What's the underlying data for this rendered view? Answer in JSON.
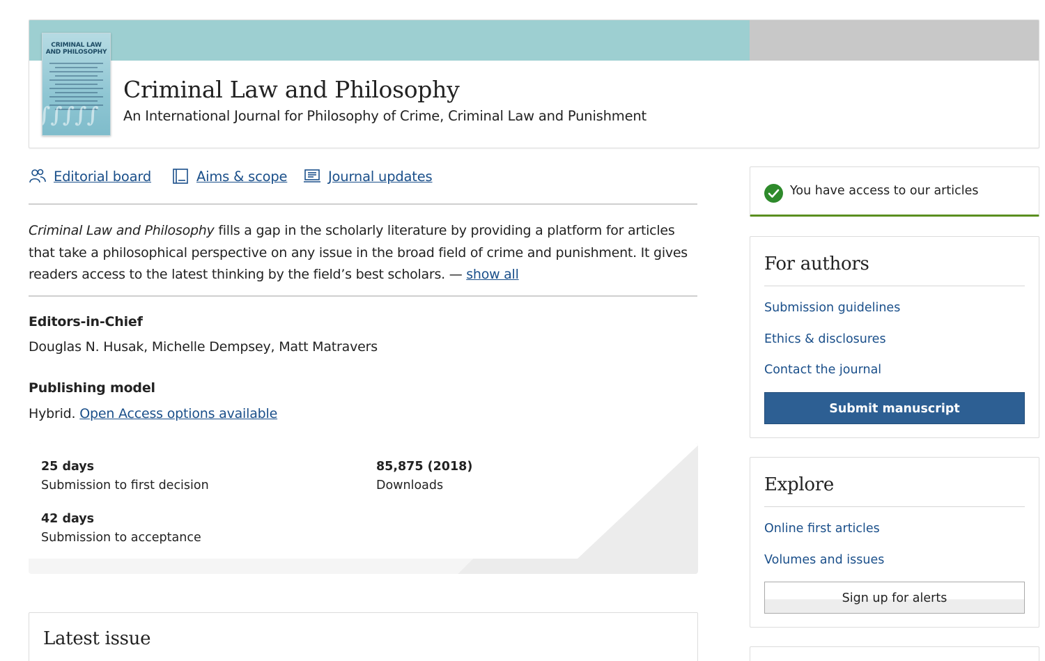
{
  "colors": {
    "header_band": "#9dcfd1",
    "header_band_end": "#c8c8c8",
    "link": "#1a4f8a",
    "primary_button": "#2d5f93",
    "access_accent": "#5a8f1f"
  },
  "header": {
    "cover_title": "CRIMINAL LAW AND PHILOSOPHY",
    "title": "Criminal Law and Philosophy",
    "subtitle": "An International Journal for Philosophy of Crime, Criminal Law and Punishment"
  },
  "nav": [
    {
      "label": "Editorial board",
      "icon": "people-icon"
    },
    {
      "label": "Aims & scope",
      "icon": "book-icon"
    },
    {
      "label": "Journal updates",
      "icon": "monitor-icon"
    }
  ],
  "description": {
    "journal_name": "Criminal Law and Philosophy",
    "text": " fills a gap in the scholarly literature by providing a platform for articles that take a philosophical perspective on any issue in the broad field of crime and punishment. It gives readers access to the latest thinking by the field’s best scholars. — ",
    "show_all": "show all"
  },
  "editors": {
    "label": "Editors-in-Chief",
    "names": "Douglas N. Husak, Michelle Dempsey, Matt Matravers"
  },
  "publishing": {
    "label": "Publishing model",
    "prefix": "Hybrid. ",
    "link": "Open Access options available"
  },
  "metrics": [
    {
      "value": "25 days",
      "description": "Submission to first decision"
    },
    {
      "value": "85,875 (2018)",
      "description": "Downloads"
    },
    {
      "value": "42 days",
      "description": "Submission to acceptance"
    }
  ],
  "latest_issue": {
    "title": "Latest issue"
  },
  "sidebar": {
    "access": "You have access to our articles",
    "for_authors": {
      "heading": "For authors",
      "links": [
        "Submission guidelines",
        "Ethics & disclosures",
        "Contact the journal"
      ],
      "button": "Submit manuscript"
    },
    "explore": {
      "heading": "Explore",
      "links": [
        "Online first articles",
        "Volumes and issues"
      ],
      "button": "Sign up for alerts"
    }
  }
}
